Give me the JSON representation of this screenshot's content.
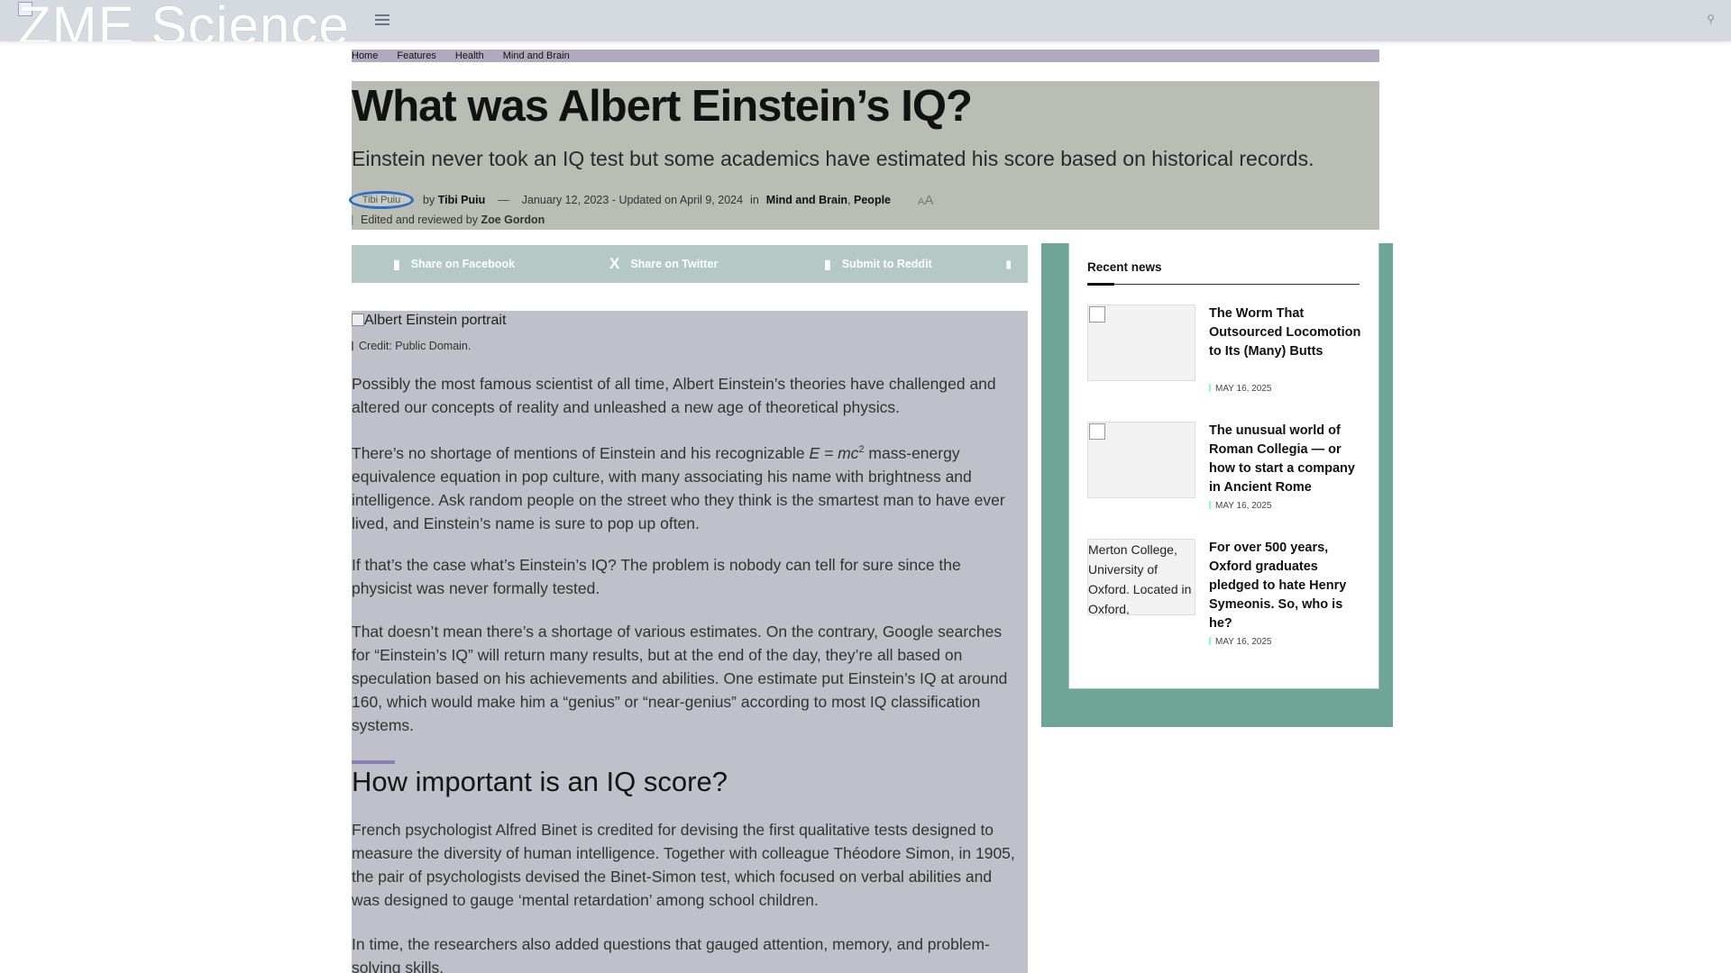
{
  "site": {
    "logo_text": "ZME Science",
    "menu_icon": "hamburger-icon",
    "search_icon": "search-icon"
  },
  "breadcrumb": [
    "Home",
    "Features",
    "Health",
    "Mind and Brain"
  ],
  "article": {
    "title": "What was Albert Einstein’s IQ?",
    "subtitle": "Einstein never took an IQ test but some academics have estimated his score based on historical records.",
    "author_avatar_alt": "Tibi Puiu",
    "by_label": "by",
    "author": "Tibi Puiu",
    "dash": "—",
    "date": "January 12, 2023 - Updated on April 9, 2024",
    "in_label": "in",
    "categories": [
      "Mind and Brain",
      "People"
    ],
    "font_small": "A",
    "font_big": "A",
    "reviewed_prefix": "Edited and reviewed by",
    "reviewer": "Zoe Gordon",
    "hero_alt": "Albert Einstein portrait",
    "credit": "Credit: Public Domain.",
    "p1": "Possibly the most famous scientist of all time, Albert Einstein’s theories have challenged and altered our concepts of reality and unleashed a new age of theoretical physics.",
    "p2_before": "There’s no shortage of mentions of Einstein and his recognizable ",
    "p2_formula": "E = mc",
    "p2_sup": "2",
    "p2_after": " mass-energy equivalence equation in pop culture, with many associating his name with brightness and intelligence. Ask random people on the street who they think is the smartest man to have ever lived, and Einstein’s name is sure to pop up often.",
    "p3": "If that’s the case what’s Einstein’s IQ? The problem is nobody can tell for sure since the physicist was never formally tested.",
    "p4": "That doesn’t mean there’s a shortage of various estimates. On the contrary, Google searches for “Einstein’s IQ” will return many results, but at the end of the day, they’re all based on speculation based on his achievements and abilities. One estimate put Einstein’s IQ at around 160, which would make him a “genius” or “near-genius” according to most IQ classification systems.",
    "h2": "How important is an IQ score?",
    "p5": "French psychologist Alfred Binet is credited for devising the first qualitative tests designed to measure the diversity of human intelligence. Together with colleague Théodore Simon, in 1905, the pair of psychologists devised the Binet-Simon test, which focused on verbal abilities and was designed to gauge ‘mental retardation’ among school children.",
    "p6": "In time, the researchers also added questions that gauged attention, memory, and problem-solving skills."
  },
  "share": {
    "facebook": "Share on Facebook",
    "twitter": "Share on Twitter",
    "reddit": "Submit to Reddit",
    "twitter_icon": "X"
  },
  "sidebar": {
    "title": "Recent news",
    "items": [
      {
        "title": "The Worm That Outsourced Locomotion to Its (Many) Butts",
        "date": "MAY 16, 2025",
        "thumb_alt": ""
      },
      {
        "title": "The unusual world of Roman Collegia — or how to start a company in Ancient Rome",
        "date": "MAY 16, 2025",
        "thumb_alt": ""
      },
      {
        "title": "For over 500 years, Oxford graduates pledged to hate Henry Symeonis. So, who is he?",
        "date": "MAY 16, 2025",
        "thumb_alt": "Merton College, University of Oxford. Located in Oxford,"
      }
    ]
  }
}
